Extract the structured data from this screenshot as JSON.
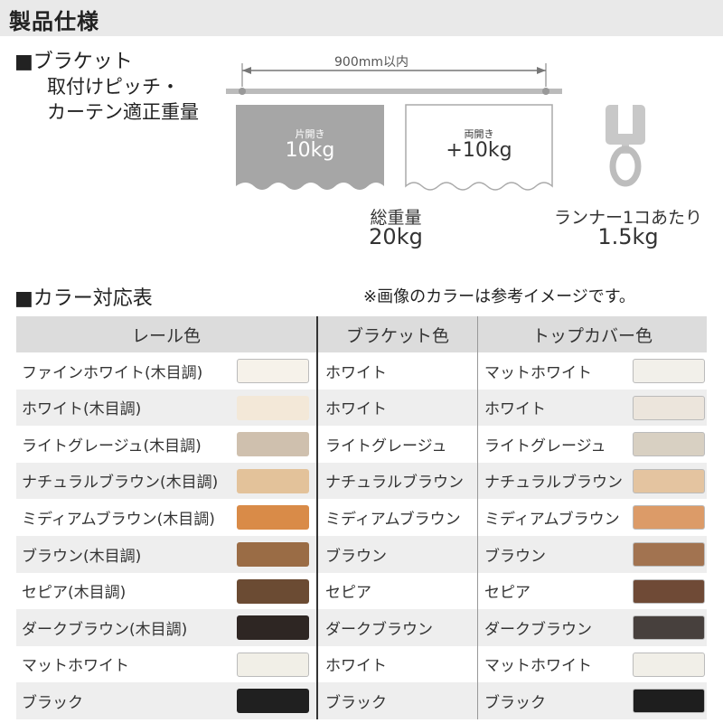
{
  "header": {
    "title": "製品仕様"
  },
  "bracket_section": {
    "title": "■ブラケット",
    "subtitle_line1": "取付けピッチ・",
    "subtitle_line2": "カーテン適正重量"
  },
  "diagram": {
    "pitch_label": "900mm以内",
    "single_open_label": "片開き",
    "single_open_weight": "10kg",
    "double_open_label": "両開き",
    "double_open_weight": "+10kg",
    "total_label": "総重量",
    "total_weight": "20kg",
    "runner_label": "ランナー1コあたり",
    "runner_weight": "1.5kg"
  },
  "color_section": {
    "title": "■カラー対応表",
    "note": "※画像のカラーは参考イメージです。"
  },
  "table": {
    "headers": [
      "レール色",
      "ブラケット色",
      "トップカバー色"
    ],
    "rows": [
      {
        "rail": "ファインホワイト(木目調)",
        "rail_color": "#f6f2ea",
        "bracket": "ホワイト",
        "cover": "マットホワイト",
        "cover_color": "#f2f0ea"
      },
      {
        "rail": "ホワイト(木目調)",
        "rail_color": "#f3e8d8",
        "bracket": "ホワイト",
        "cover": "ホワイト",
        "cover_color": "#ece5dc"
      },
      {
        "rail": "ライトグレージュ(木目調)",
        "rail_color": "#cfc0ae",
        "bracket": "ライトグレージュ",
        "cover": "ライトグレージュ",
        "cover_color": "#d8d0c2"
      },
      {
        "rail": "ナチュラルブラウン(木目調)",
        "rail_color": "#e3c29a",
        "bracket": "ナチュラルブラウン",
        "cover": "ナチュラルブラウン",
        "cover_color": "#e4c4a0"
      },
      {
        "rail": "ミディアムブラウン(木目調)",
        "rail_color": "#d98b48",
        "bracket": "ミディアムブラウン",
        "cover": "ミディアムブラウン",
        "cover_color": "#dc9b68"
      },
      {
        "rail": "ブラウン(木目調)",
        "rail_color": "#9a6c45",
        "bracket": "ブラウン",
        "cover": "ブラウン",
        "cover_color": "#a27350"
      },
      {
        "rail": "セピア(木目調)",
        "rail_color": "#6b4b33",
        "bracket": "セピア",
        "cover": "セピア",
        "cover_color": "#6f4a36"
      },
      {
        "rail": "ダークブラウン(木目調)",
        "rail_color": "#2e2623",
        "bracket": "ダークブラウン",
        "cover": "ダークブラウン",
        "cover_color": "#47403d"
      },
      {
        "rail": "マットホワイト",
        "rail_color": "#f1efe7",
        "bracket": "ホワイト",
        "cover": "マットホワイト",
        "cover_color": "#f1efe8"
      },
      {
        "rail": "ブラック",
        "rail_color": "#202020",
        "bracket": "ブラック",
        "cover": "ブラック",
        "cover_color": "#1e1e1e"
      }
    ]
  }
}
